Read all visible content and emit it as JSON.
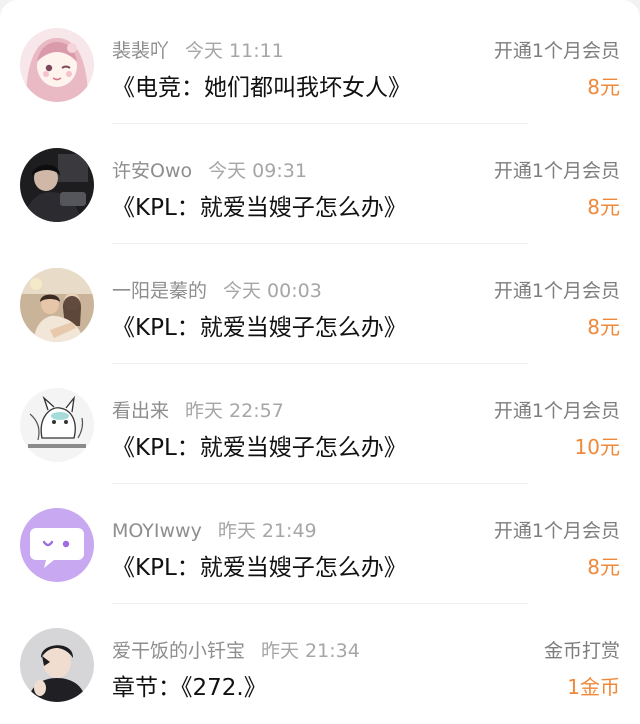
{
  "colors": {
    "accent": "#f0883a",
    "title_text": "#111111",
    "meta_text": "#8e8e8e",
    "divider": "#efefef"
  },
  "records": [
    {
      "username": "裴裴吖",
      "time": "今天 11:11",
      "title": "《电竞：她们都叫我坏女人》",
      "action": "开通1个月会员",
      "amount": "8元",
      "avatar": "anime-girl-pink-avatar"
    },
    {
      "username": "许安Owo",
      "time": "今天 09:31",
      "title": "《KPL：就爱当嫂子怎么办》",
      "action": "开通1个月会员",
      "amount": "8元",
      "avatar": "dark-photo-avatar"
    },
    {
      "username": "一阳是蓁的",
      "time": "今天 00:03",
      "title": "《KPL：就爱当嫂子怎么办》",
      "action": "开通1个月会员",
      "amount": "8元",
      "avatar": "couple-photo-avatar"
    },
    {
      "username": "看出来",
      "time": "昨天 22:57",
      "title": "《KPL：就爱当嫂子怎么办》",
      "action": "开通1个月会员",
      "amount": "10元",
      "avatar": "sketch-cat-avatar"
    },
    {
      "username": "MOYIwwy",
      "time": "昨天 21:49",
      "title": "《KPL：就爱当嫂子怎么办》",
      "action": "开通1个月会员",
      "amount": "8元",
      "avatar": "purple-chat-bubble-avatar"
    },
    {
      "username": "爱干饭的小钎宝",
      "time": "昨天 21:34",
      "title": "章节：《272.》",
      "action": "金币打赏",
      "amount": "1金币",
      "avatar": "young-man-photo-avatar"
    }
  ]
}
